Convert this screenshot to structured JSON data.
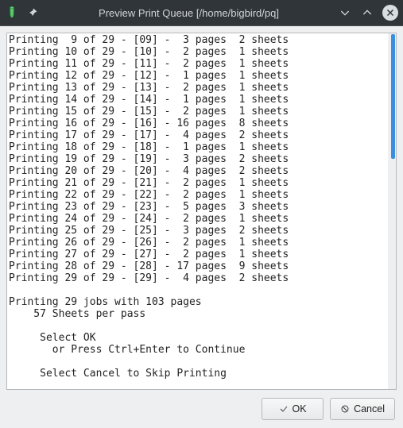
{
  "titlebar": {
    "title": "Preview Print Queue  [/home/bigbird/pq]"
  },
  "print_lines": [
    "Printing  9 of 29 - [09] -  3 pages  2 sheets",
    "Printing 10 of 29 - [10] -  2 pages  1 sheets",
    "Printing 11 of 29 - [11] -  2 pages  1 sheets",
    "Printing 12 of 29 - [12] -  1 pages  1 sheets",
    "Printing 13 of 29 - [13] -  2 pages  1 sheets",
    "Printing 14 of 29 - [14] -  1 pages  1 sheets",
    "Printing 15 of 29 - [15] -  2 pages  1 sheets",
    "Printing 16 of 29 - [16] - 16 pages  8 sheets",
    "Printing 17 of 29 - [17] -  4 pages  2 sheets",
    "Printing 18 of 29 - [18] -  1 pages  1 sheets",
    "Printing 19 of 29 - [19] -  3 pages  2 sheets",
    "Printing 20 of 29 - [20] -  4 pages  2 sheets",
    "Printing 21 of 29 - [21] -  2 pages  1 sheets",
    "Printing 22 of 29 - [22] -  2 pages  1 sheets",
    "Printing 23 of 29 - [23] -  5 pages  3 sheets",
    "Printing 24 of 29 - [24] -  2 pages  1 sheets",
    "Printing 25 of 29 - [25] -  3 pages  2 sheets",
    "Printing 26 of 29 - [26] -  2 pages  1 sheets",
    "Printing 27 of 29 - [27] -  2 pages  1 sheets",
    "Printing 28 of 29 - [28] - 17 pages  9 sheets",
    "Printing 29 of 29 - [29] -  4 pages  2 sheets"
  ],
  "summary": {
    "line1": "Printing 29 jobs with 103 pages",
    "line2": "    57 Sheets per pass",
    "line3": "",
    "line4": "     Select OK",
    "line5": "       or Press Ctrl+Enter to Continue",
    "line6": "",
    "line7": "     Select Cancel to Skip Printing"
  },
  "buttons": {
    "ok": "OK",
    "cancel": "Cancel"
  }
}
